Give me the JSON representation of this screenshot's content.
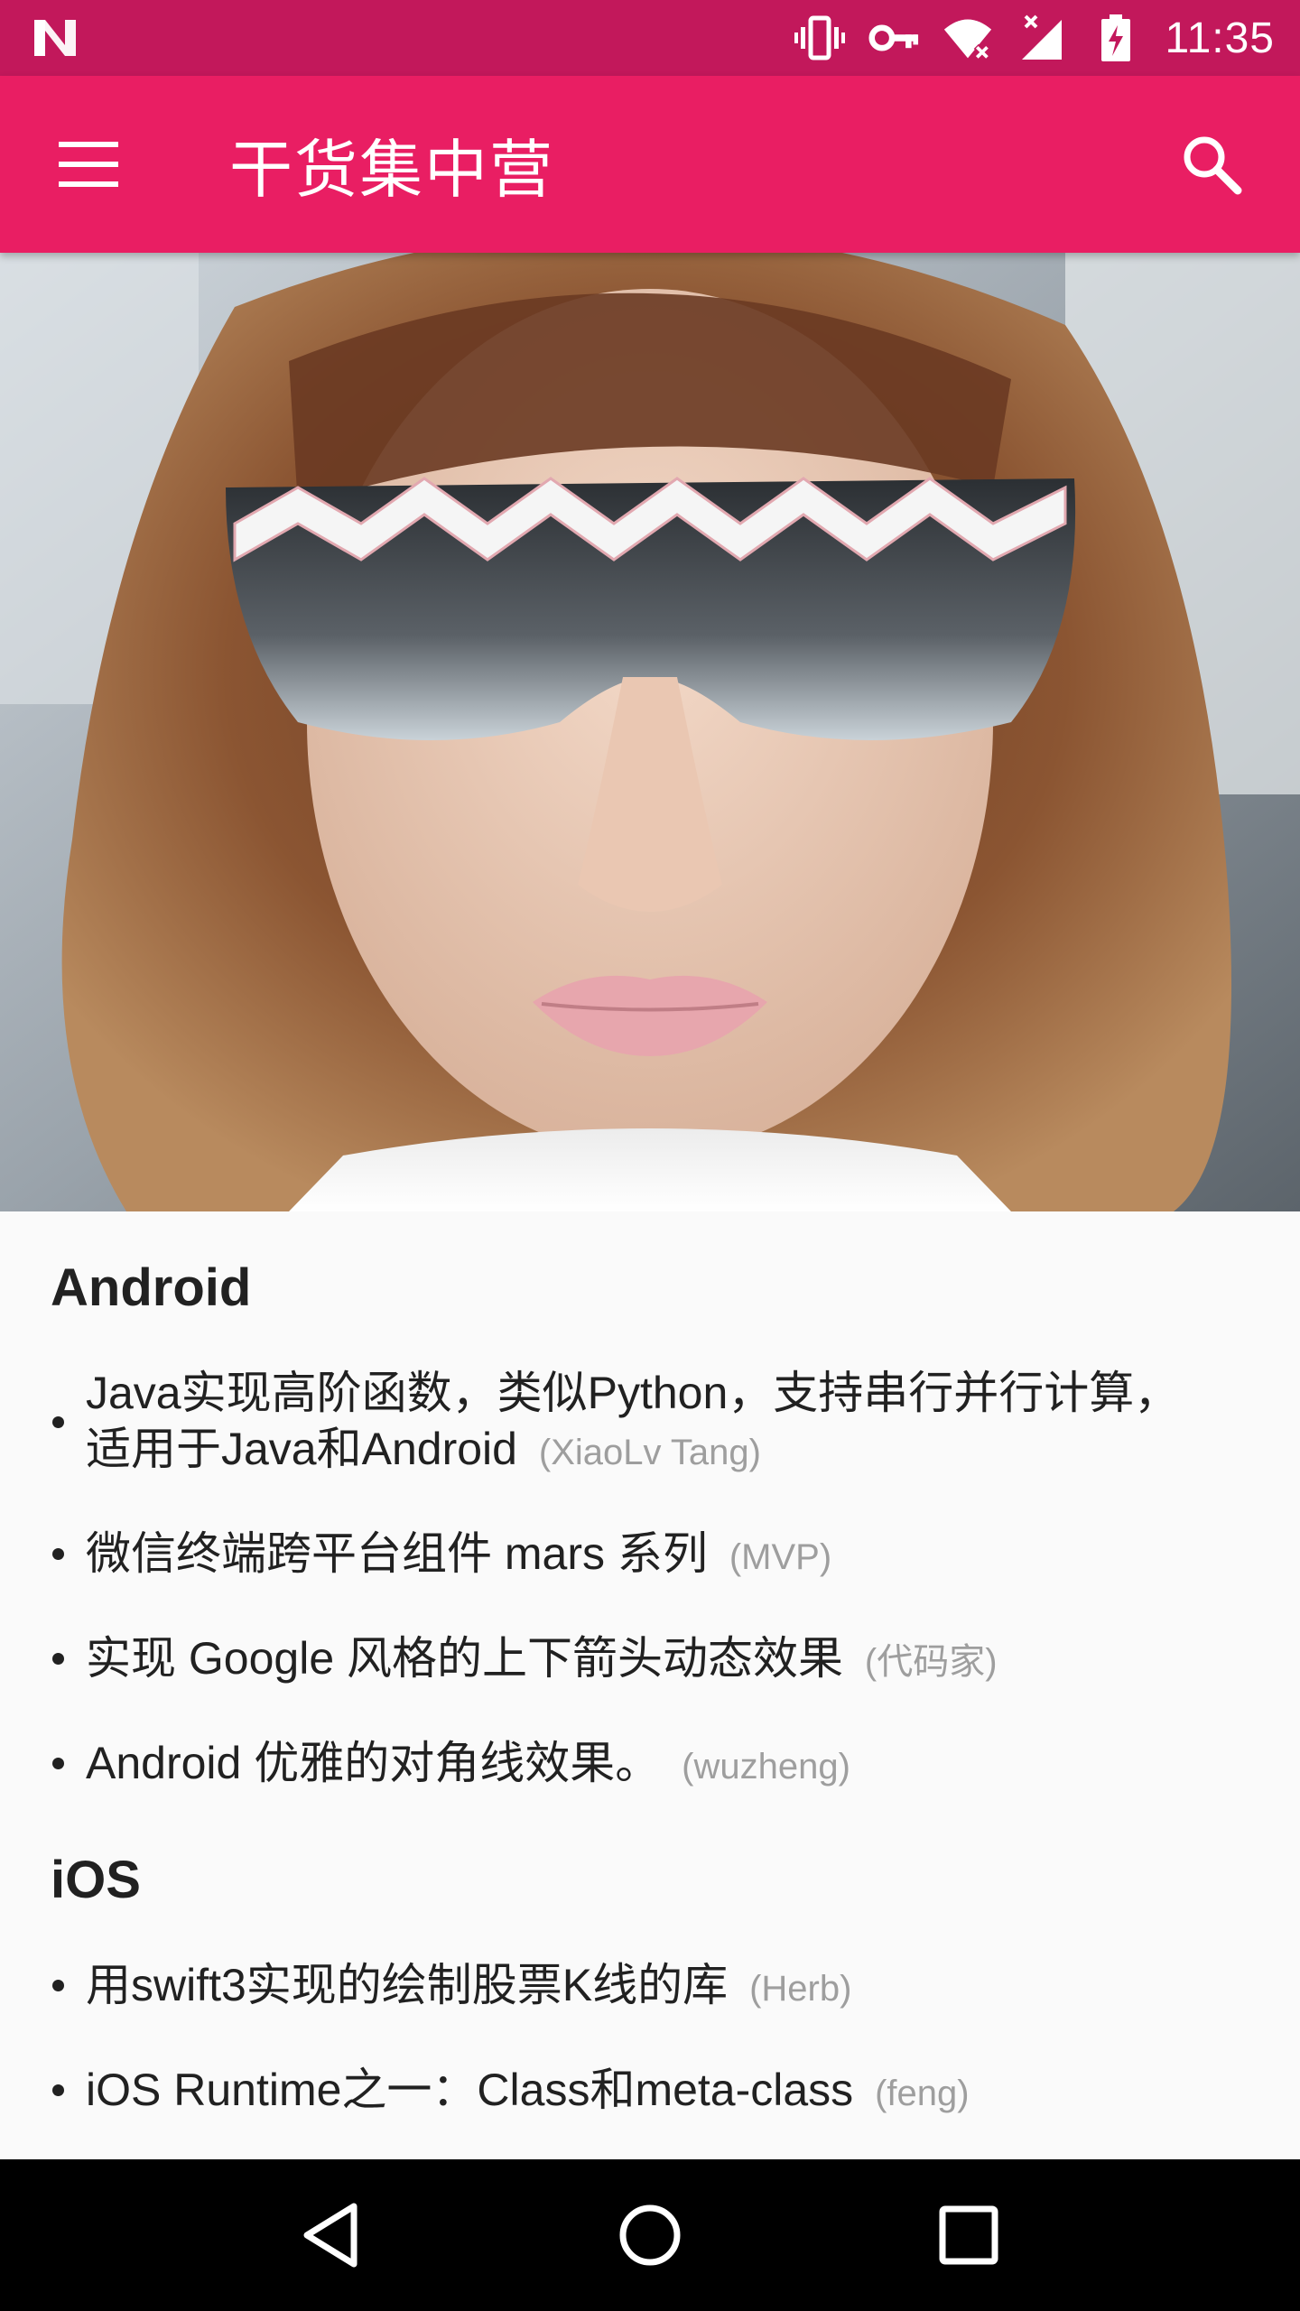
{
  "status_bar": {
    "time": "11:35",
    "icons": [
      "notification-n-icon",
      "vibrate-icon",
      "vpn-key-icon",
      "wifi-icon",
      "signal-icon",
      "battery-charging-icon"
    ],
    "background_color": "#c2185b"
  },
  "app_bar": {
    "title": "干货集中营",
    "menu_icon": "hamburger-menu-icon",
    "search_icon": "search-icon",
    "background_color": "#e91e63"
  },
  "hero": {
    "image": "photo-woman-with-reflective-zigzag-sunglasses"
  },
  "sections": {
    "android": {
      "title": "Android",
      "items": [
        {
          "line1": "Java实现高阶函数，类似Python，支持串行并行计算，",
          "line2": "适用于Java和Android",
          "author": "(XiaoLv Tang)"
        },
        {
          "text": "微信终端跨平台组件 mars 系列",
          "author": "(MVP)"
        },
        {
          "text": "实现 Google 风格的上下箭头动态效果",
          "author": "(代码家)"
        },
        {
          "text": "Android 优雅的对角线效果。",
          "author": "(wuzheng)"
        }
      ]
    },
    "ios": {
      "title": "iOS",
      "items": [
        {
          "text": "用swift3实现的绘制股票K线的库",
          "author": "(Herb)"
        },
        {
          "text": "iOS Runtime之一：Class和meta-class",
          "author": "(feng)"
        }
      ]
    }
  },
  "nav_bar": {
    "back_icon": "back-triangle-icon",
    "home_icon": "home-circle-icon",
    "recents_icon": "recents-square-icon"
  }
}
